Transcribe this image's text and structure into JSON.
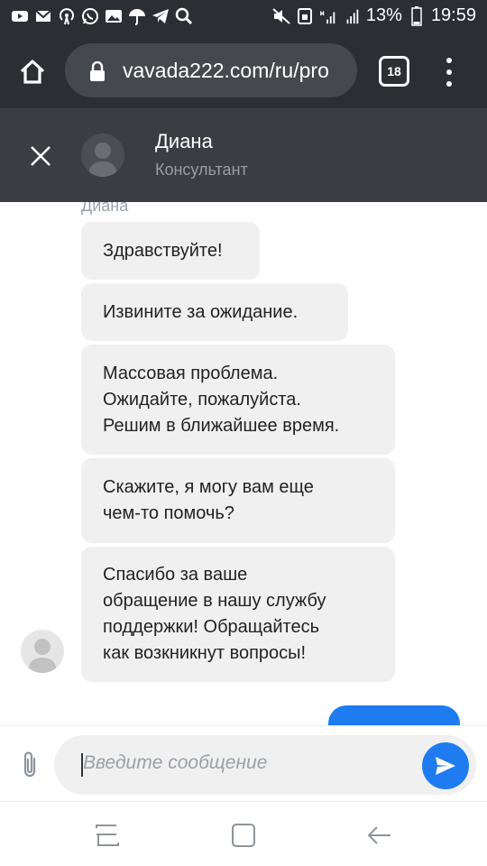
{
  "status_bar": {
    "battery": "13%",
    "time": "19:59"
  },
  "browser": {
    "url": "vavada222.com/ru/pro",
    "tab_count": "18"
  },
  "chat_header": {
    "agent_name": "Диана",
    "agent_role": "Консультант"
  },
  "messages": {
    "sender_label": "Диана",
    "items": [
      {
        "text": "Здравствуйте!"
      },
      {
        "text": "Извините за ожидание."
      },
      {
        "text": "Массовая проблема.\nОжидайте, пожалуйста.\nРешим в ближайшее время."
      },
      {
        "text": "Скажите, я могу вам еще\nчем-то помочь?"
      },
      {
        "text": "Спасибо за ваше\nобращение в нашу службу\nподдержки! Обращайтесь\nкак возкникнут вопросы!"
      }
    ]
  },
  "composer": {
    "placeholder": "Введите сообщение"
  },
  "colors": {
    "accent": "#1e7cf0",
    "header_bg": "#3a3d41",
    "browser_bg": "#2b2e33",
    "bubble_bg": "#f0f0f0"
  }
}
